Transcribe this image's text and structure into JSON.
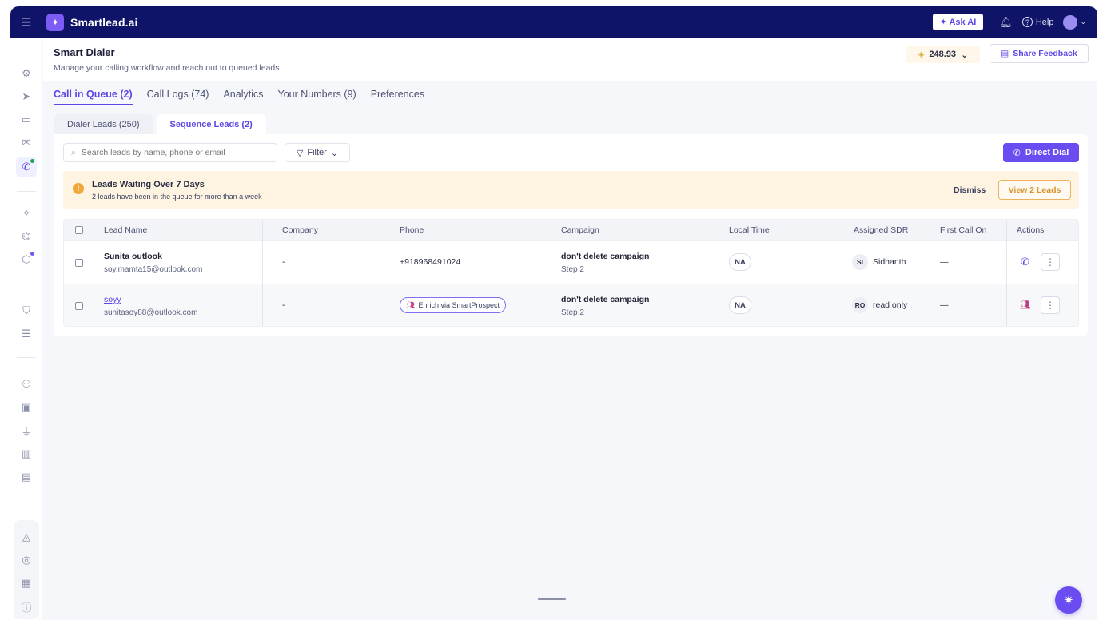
{
  "topbar": {
    "brand": "Smartlead.ai",
    "ask_ai_label": "✦ Ask AI",
    "help_label": "Help"
  },
  "header": {
    "title": "Smart Dialer",
    "subtitle": "Manage your calling workflow and reach out to queued leads",
    "credits": "248.93",
    "feedback_label": "Share Feedback"
  },
  "tabs": [
    {
      "label": "Call in Queue (2)",
      "active": true
    },
    {
      "label": "Call Logs (74)",
      "active": false
    },
    {
      "label": "Analytics",
      "active": false
    },
    {
      "label": "Your Numbers (9)",
      "active": false
    },
    {
      "label": "Preferences",
      "active": false
    }
  ],
  "subtabs": [
    {
      "label": "Dialer Leads (250)",
      "active": false
    },
    {
      "label": "Sequence Leads (2)",
      "active": true
    }
  ],
  "toolbar": {
    "search_placeholder": "Search leads by name, phone or email",
    "filter_label": "Filter",
    "direct_dial_label": "Direct Dial"
  },
  "banner": {
    "title": "Leads Waiting Over 7 Days",
    "subtitle": "2 leads have been in the queue for more than a week",
    "dismiss_label": "Dismiss",
    "view_label": "View 2 Leads"
  },
  "table": {
    "headers": [
      "Lead Name",
      "Company",
      "Phone",
      "Campaign",
      "Local Time",
      "Assigned SDR",
      "First Call On",
      "Actions"
    ],
    "rows": [
      {
        "name": "Sunita outlook",
        "email": "soy.mamta15@outlook.com",
        "company": "-",
        "phone": "+918968491024",
        "campaign": "don't delete campaign",
        "step": "Step 2",
        "local_time": "NA",
        "sdr_initials": "SI",
        "sdr_name": "Sidhanth",
        "first_call": "—"
      },
      {
        "name": "soyy",
        "email": "sunitasoy88@outlook.com",
        "company": "-",
        "phone_action": "Enrich via SmartProspect",
        "campaign": "don't delete campaign",
        "step": "Step 2",
        "local_time": "NA",
        "sdr_initials": "RO",
        "sdr_name": "read only",
        "first_call": "—"
      }
    ]
  },
  "colors": {
    "topbar": "#0f1468",
    "accent": "#6a4cf0",
    "banner": "#fff4e2",
    "warning": "#f0a73a"
  }
}
